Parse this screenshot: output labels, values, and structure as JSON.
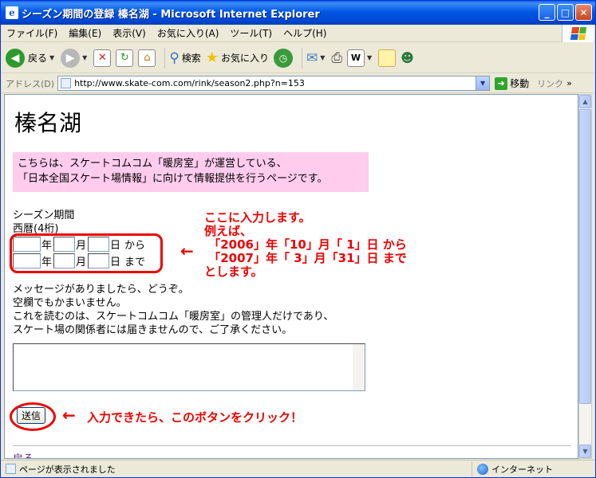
{
  "window": {
    "title": "シーズン期間の登録 榛名湖 - Microsoft Internet Explorer"
  },
  "menu": [
    "ファイル(F)",
    "編集(E)",
    "表示(V)",
    "お気に入り(A)",
    "ツール(T)",
    "ヘルプ(H)"
  ],
  "toolbar": {
    "back": "戻る",
    "search": "検索",
    "favorites": "お気に入り"
  },
  "address": {
    "label": "アドレス(D)",
    "url": "http://www.skate-com.com/rink/season2.php?n=153",
    "go": "移動",
    "links": "リンク"
  },
  "page": {
    "title": "榛名湖",
    "notice_line1": "こちらは、スケートコムコム「暖房室」が運営している、",
    "notice_line2": "「日本全国スケート場情報」に向けて情報提供を行うページです。",
    "season_label": "シーズン期間",
    "year_hint": "西暦(4桁)",
    "year_unit": "年",
    "month_unit": "月",
    "day_unit": "日",
    "from_word": "から",
    "until_word": "まで",
    "message_line1": "メッセージがありましたら、どうぞ。",
    "message_line2": "空欄でもかまいません。",
    "message_line3": "これを読むのは、スケートコムコム「暖房室」の管理人だけであり、",
    "message_line4": "スケート場の関係者には届きませんので、ご了承ください。",
    "submit": "送信",
    "back_link": "戻る"
  },
  "annotation": {
    "arrow": "←",
    "lines": "ここに入力します。\n例えば、\n 「2006」年「10」月「 1」日 から\n 「2007」年「 3」月「31」日 まで\nとします。",
    "click_text": "入力できたら、このボタンをクリック！"
  },
  "status": {
    "left": "ページが表示されました",
    "zone": "インターネット"
  }
}
